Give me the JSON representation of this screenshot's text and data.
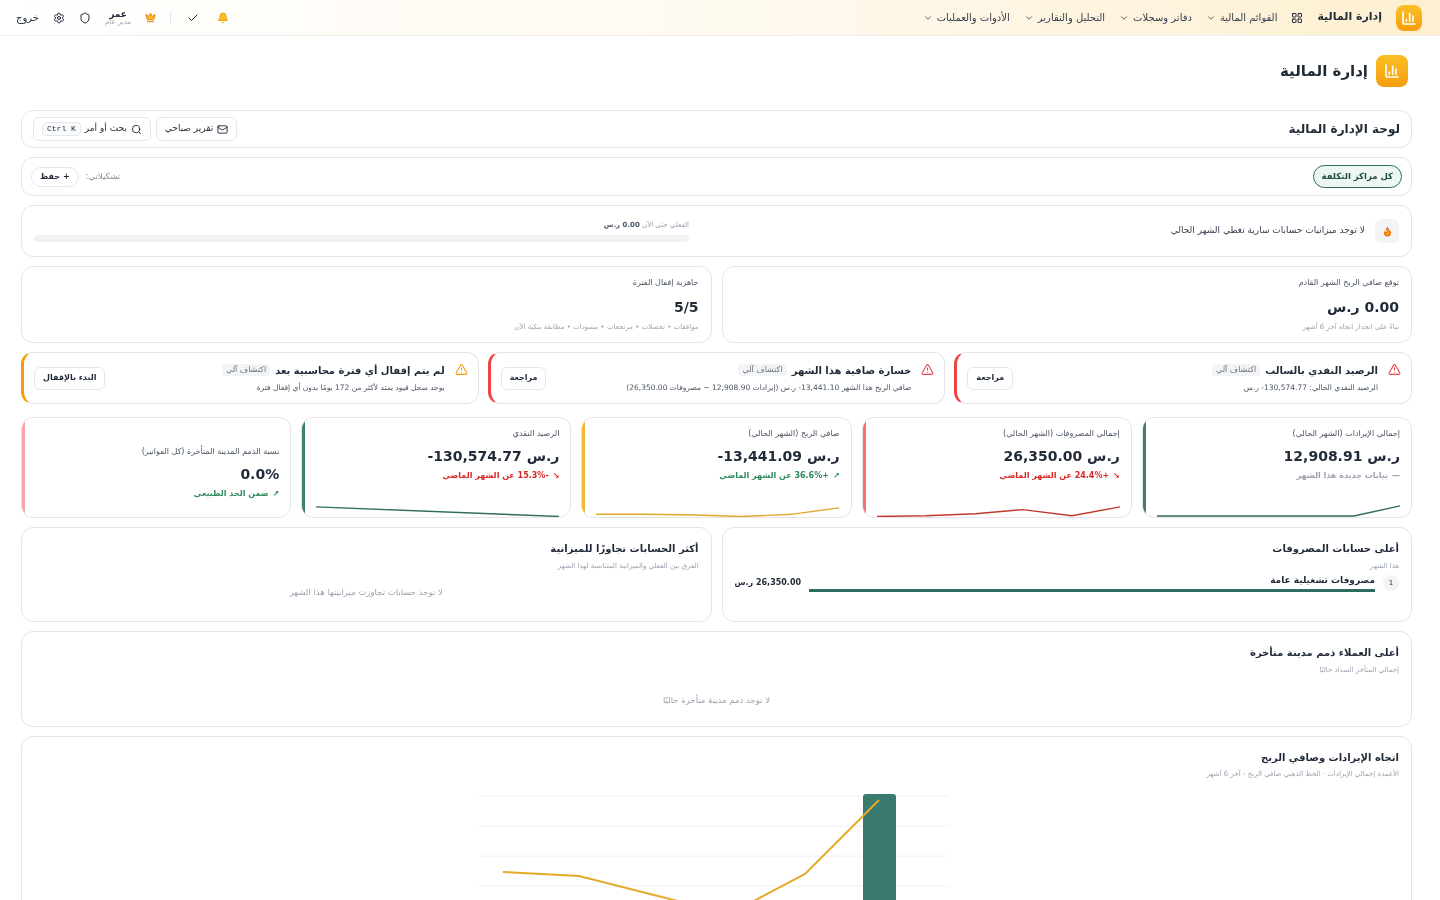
{
  "topbar": {
    "brand": "إدارة المالية",
    "menus": [
      {
        "label": "القوائم المالية"
      },
      {
        "label": "دفاتر وسجلات"
      },
      {
        "label": "التحليل والتقارير"
      },
      {
        "label": "الأدوات والعمليات"
      }
    ],
    "user": {
      "name": "عمر",
      "role": "مدير عام"
    },
    "logout": "خروج"
  },
  "page_title": "إدارة المالية",
  "dashboard": {
    "title": "لوحة الإدارة المالية",
    "report_button": "تقرير صباحي",
    "search": {
      "placeholder": "بحث أو أمر",
      "shortcut": "Ctrl K"
    }
  },
  "filters": {
    "chips": [
      {
        "label": "كل مراكز التكلفة",
        "selected": true
      }
    ],
    "saved_label": "تشكيلاتي:",
    "save_button": "+ حفظ"
  },
  "budget": {
    "message": "لا توجد ميزانيات حسابات سارية تغطي الشهر الحالي",
    "actual_label": "الفعلي حتى الآن",
    "actual_value": "0.00 ر.س",
    "level": 0
  },
  "info_cards": [
    {
      "title": "توقع صافي الربح الشهر القادم",
      "value": "0.00 ر.س",
      "note": "بناءً على انحدار اتجاه آخر 6 أشهر"
    },
    {
      "title": "جاهزية إقفال الفترة",
      "value": "5/5",
      "note": "موافقات • تحصلات • مرتجعات • مسودات • مطابقة بنكية الآن"
    }
  ],
  "alerts": [
    {
      "title": "الرصيد النقدي بالسالب",
      "badge": "اكتشاف آلي",
      "description": "الرصيد النقدي الحالي: ‎-130,574.77 ر.س",
      "action": "مراجعة",
      "color": "#ef4444"
    },
    {
      "title": "خسارة صافية هذا الشهر",
      "badge": "اكتشاف آلي",
      "description": "صافي الربح هذا الشهر ‎-13,441.10 ر.س (إيرادات 12,908.90 − مصروفات 26,350.00)",
      "action": "مراجعة",
      "color": "#ef4444"
    },
    {
      "title": "لم يتم إقفال أي فترة محاسبية بعد",
      "badge": "اكتشاف آلي",
      "description": "يوجد سجل قيود يمتد لأكثر من 172 يومًا بدون أي إقفال فترة",
      "action": "البدء بالإقفال",
      "color": "#f59e0b"
    }
  ],
  "kpis": [
    {
      "kind": "sparkline",
      "title": "إجمالي الإيرادات (الشهر الحالي)",
      "value": "12,908.91 ر.س",
      "trend": "—",
      "change": {
        "text": "بيانات جديدة هذا الشهر",
        "color": "#9ca3af"
      },
      "color": "#3f7f72"
    },
    {
      "kind": "sparkline",
      "title": "إجمالي المصروفات (الشهر الحالي)",
      "value": "26,350.00 ر.س",
      "trend": "↘",
      "change": {
        "text": "+24.4% عن الشهر الماضي",
        "color": "#dc2626"
      },
      "color": "#f87171"
    },
    {
      "kind": "sparkline",
      "title": "صافي الربح (الشهر الحالي)",
      "value": "-13,441.09 ر.س",
      "trend": "↗",
      "change": {
        "text": "+36.6% عن الشهر الماضي",
        "color": "#2f8a5e"
      },
      "color": "#f5b731"
    },
    {
      "kind": "sparkline",
      "title": "الرصيد النقدي",
      "value": "-130,574.77 ر.س",
      "trend": "↘",
      "change": {
        "text": "-15.3% عن الشهر الماضي",
        "color": "#dc2626"
      },
      "color": "#3f7f72"
    },
    {
      "kind": "plain",
      "title": "نسبة الذمم المدينة المتأخرة (كل الفواتير)",
      "value": "0.0%",
      "trend": "↗",
      "change": {
        "text": "ضمن الحد الطبيعي",
        "color": "#2f8a5e"
      },
      "color": "#f8a5a5"
    }
  ],
  "top_expenses": {
    "title": "أعلى حسابات المصروفات",
    "subtitle": "هذا الشهر",
    "rows": [
      {
        "rank": "1",
        "name": "مصروفات تشغيلية عامة",
        "level": 1,
        "amount": "26,350.00 ر.س"
      }
    ]
  },
  "over_budget": {
    "title": "أكثر الحسابات تجاوزًا للميزانية",
    "subtitle": "الفرق بين الفعلي والميزانية المتناسبة لهذا الشهر",
    "empty": "لا توجد حسابات تجاوزت ميزانيتها هذا الشهر"
  },
  "overdue": {
    "title": "أعلى العملاء ذمم مدينة متأخرة",
    "subtitle": "إجمالي المتأخر السداد حاليًا",
    "empty": "لا توجد ذمم مدينة متأخرة حاليًا"
  },
  "trend_chart": {
    "title": "اتجاه الإيرادات وصافي الربح",
    "subtitle": "الأعمدة إجمالي الإيرادات · الخط الذهبي صافي الربح - آخر 6 أشهر"
  }
}
